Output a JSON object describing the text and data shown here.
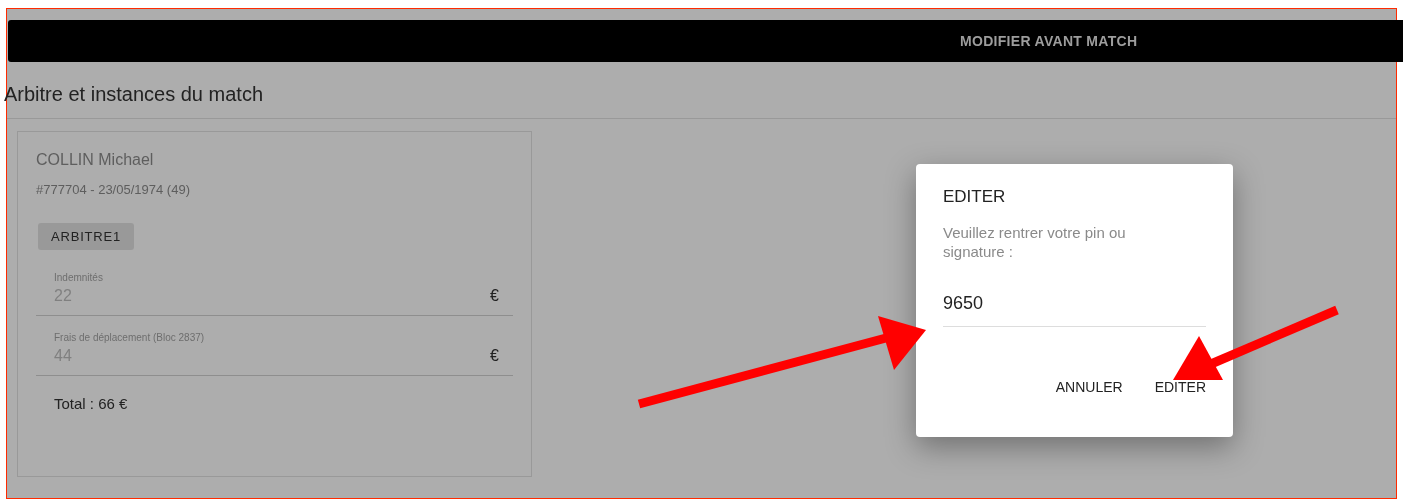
{
  "header": {
    "button": "MODIFIER AVANT MATCH"
  },
  "section": {
    "title": "Arbitre et instances du match"
  },
  "official": {
    "name": "COLLIN Michael",
    "details": "#777704 - 23/05/1974 (49)",
    "role": "ARBITRE1",
    "fields": [
      {
        "label": "Indemnités",
        "value": "22",
        "unit": "€"
      },
      {
        "label": "Frais de déplacement (Bloc 2837)",
        "value": "44",
        "unit": "€"
      }
    ],
    "total": "Total : 66 €"
  },
  "dialog": {
    "title": "EDITER",
    "message": "Veuillez rentrer votre pin ou signature :",
    "pin": "9650",
    "buttons": [
      "ANNULER",
      "EDITER"
    ]
  }
}
